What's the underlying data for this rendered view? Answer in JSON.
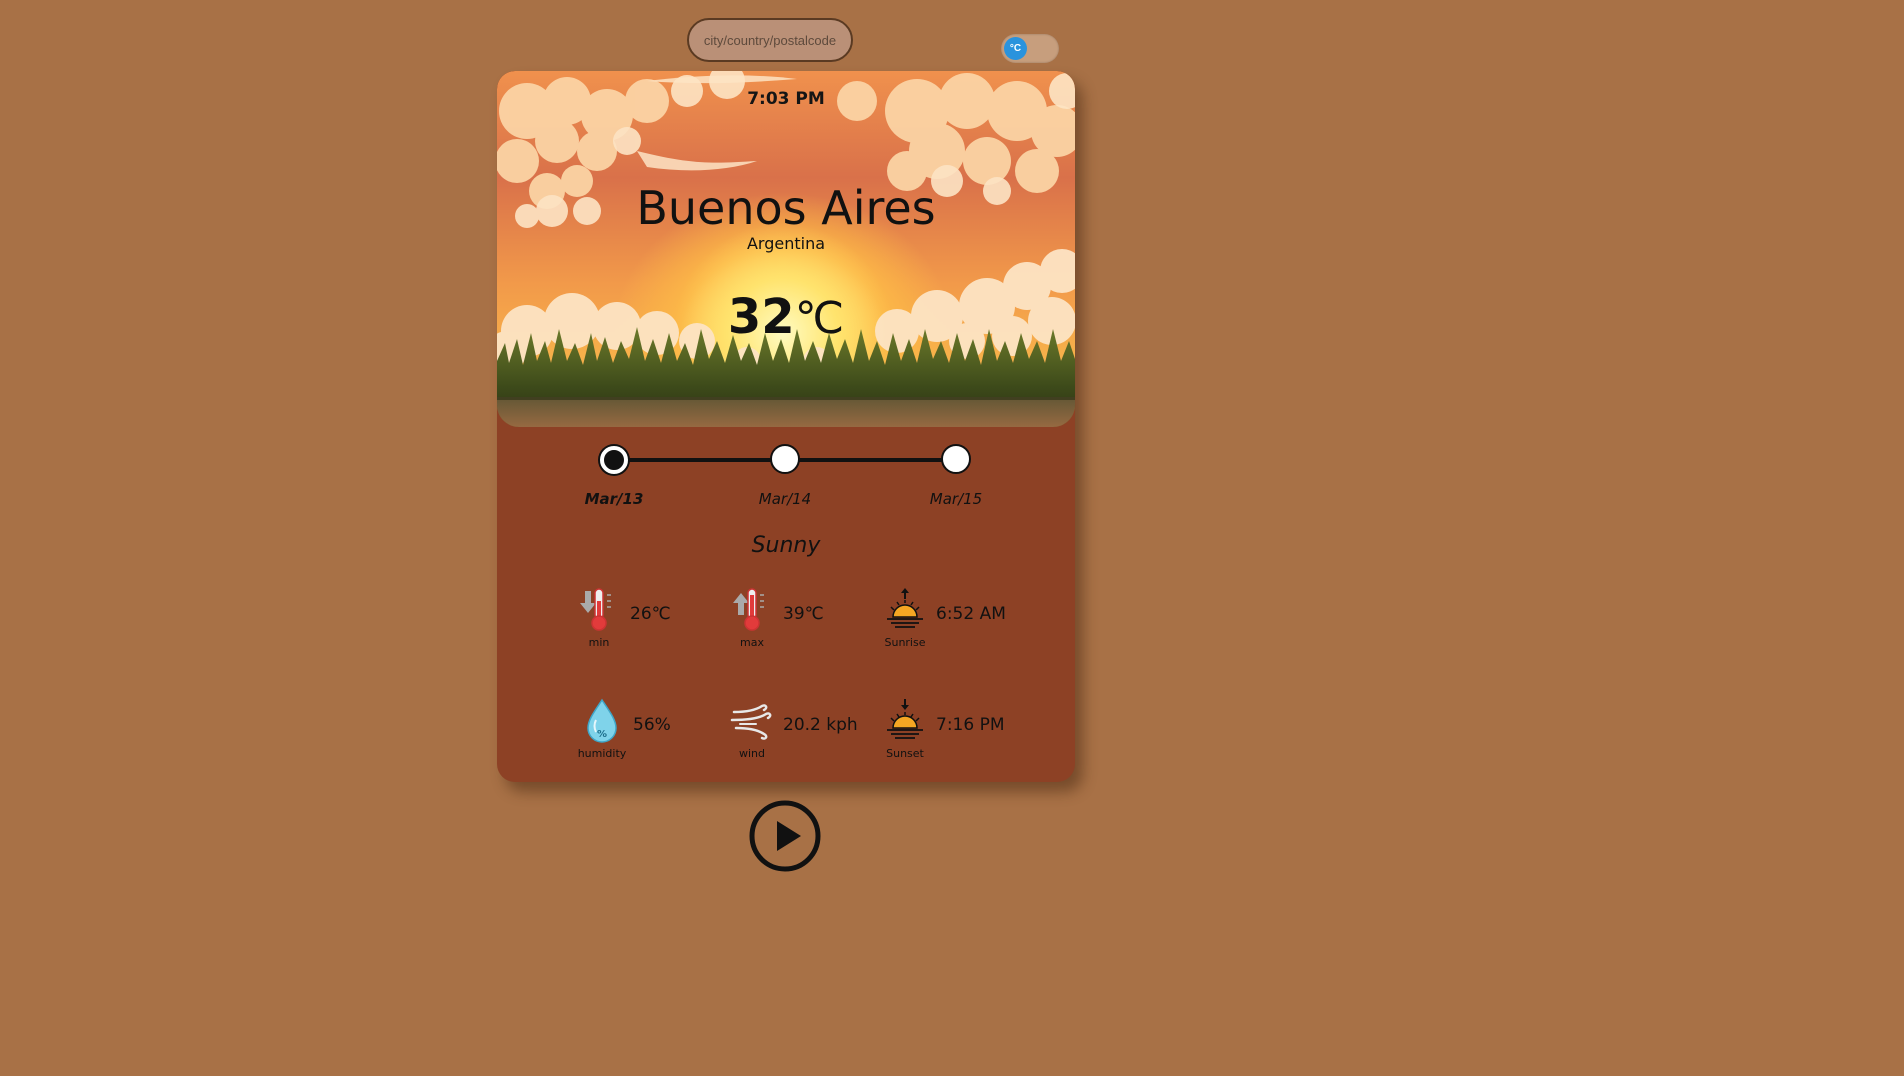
{
  "search": {
    "placeholder": "city/country/postalcode",
    "value": ""
  },
  "unit_toggle": {
    "label": "°C",
    "selected": "C",
    "accent_color": "#2a93dd"
  },
  "colors": {
    "background": "#a87146",
    "card": "#8d4125",
    "text": "#111111"
  },
  "weather": {
    "time": "7:03 PM",
    "city": "Buenos Aires",
    "country": "Argentina",
    "temperature": "32",
    "temperature_unit": "℃",
    "condition": "Sunny",
    "hero_scene": "sunset-clouds-grass"
  },
  "timeline": {
    "dates": [
      {
        "label": "Mar/13",
        "active": true
      },
      {
        "label": "Mar/14",
        "active": false
      },
      {
        "label": "Mar/15",
        "active": false
      }
    ]
  },
  "stats": {
    "min": {
      "icon": "thermometer-down-icon",
      "caption": "min",
      "value": "26℃"
    },
    "max": {
      "icon": "thermometer-up-icon",
      "caption": "max",
      "value": "39℃"
    },
    "sunrise": {
      "icon": "sunrise-icon",
      "caption": "Sunrise",
      "value": "6:52 AM"
    },
    "humidity": {
      "icon": "humidity-drop-icon",
      "caption": "humidity",
      "value": "56%"
    },
    "wind": {
      "icon": "wind-icon",
      "caption": "wind",
      "value": "20.2 kph"
    },
    "sunset": {
      "icon": "sunset-icon",
      "caption": "Sunset",
      "value": "7:16 PM"
    }
  },
  "player": {
    "icon": "play-icon"
  }
}
